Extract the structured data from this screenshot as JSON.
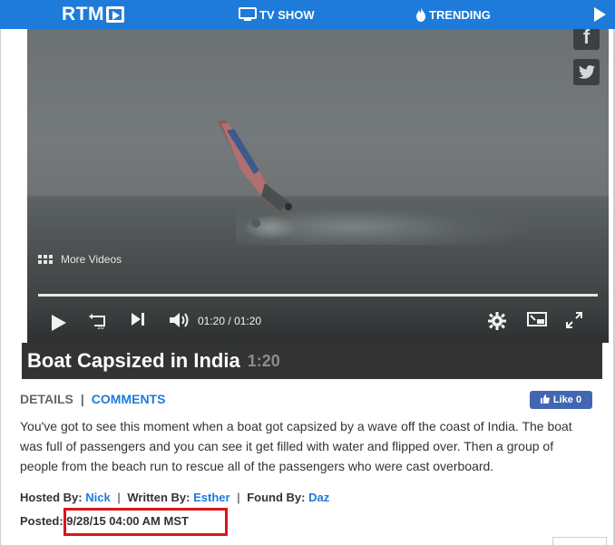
{
  "nav": {
    "logo": "RTM",
    "tv_show": "TV SHOW",
    "trending": "TRENDING"
  },
  "video": {
    "more_videos": "More Videos",
    "current_time": "01:20",
    "separator": "/",
    "total_time": "01:20",
    "progress": 1.0,
    "social": {
      "facebook": "f"
    }
  },
  "article": {
    "title": "Boat Capsized in India",
    "duration": "1:20",
    "tabs": {
      "details": "DETAILS",
      "separator": "|",
      "comments": "COMMENTS"
    },
    "like_button": "Like 0",
    "description": "You've got to see this moment when a boat got capsized by a wave off the coast of India. The boat was full of passengers and you can see it get filled with water and flipped over. Then a group of people from the beach run to rescue all of the passengers who were cast overboard.",
    "credits": {
      "hosted_label": "Hosted By:",
      "hosted_name": "Nick",
      "written_label": "Written By:",
      "written_name": "Esther",
      "found_label": "Found By:",
      "found_name": "Daz",
      "separator": "|"
    },
    "posted_label": "Posted:",
    "posted_date": "9/28/15 04:00 AM MST"
  },
  "colors": {
    "nav_blue": "#1e7bd9",
    "title_bar": "#333333",
    "link_blue": "#1e7bd9",
    "highlight_red": "#d9161a",
    "facebook_blue": "#4267b2"
  }
}
